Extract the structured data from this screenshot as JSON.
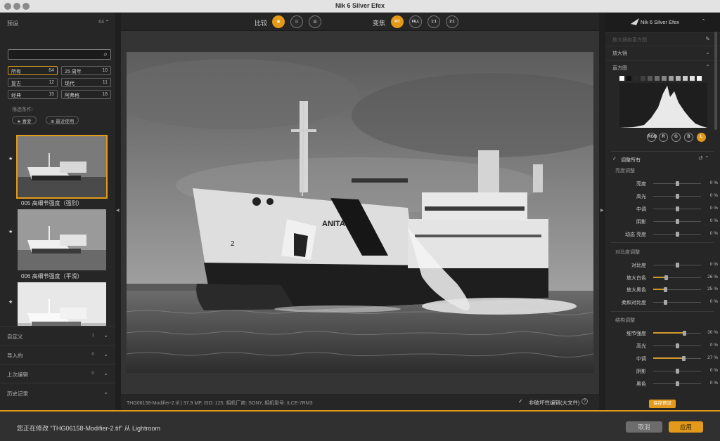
{
  "window": {
    "title": "Nik 6 Silver Efex"
  },
  "left": {
    "presets_label": "预设",
    "presets_count": "64",
    "search_placeholder": "",
    "filters": [
      {
        "label": "所有",
        "count": "64",
        "active": true
      },
      {
        "label": "25 周年",
        "count": "10"
      },
      {
        "label": "复古",
        "count": "12"
      },
      {
        "label": "现代",
        "count": "11"
      },
      {
        "label": "经典",
        "count": "15"
      },
      {
        "label": "阿弗格",
        "count": "16"
      }
    ],
    "filter_conditions_label": "筛选条件:",
    "pills": [
      "★ 喜爱",
      "⊕ 最近使用"
    ],
    "thumbs": [
      {
        "caption": "005 高细节强度（强烈）"
      },
      {
        "caption": "006 高细节强度（平滑）"
      },
      {
        "caption": ""
      }
    ],
    "sections": [
      {
        "label": "自定义",
        "count": "1"
      },
      {
        "label": "导入的",
        "count": "0"
      },
      {
        "label": "上次编辑",
        "count": "0"
      },
      {
        "label": "历史记录",
        "count": ""
      }
    ]
  },
  "toolbar": {
    "compare_label": "比较",
    "zoom_label": "变焦",
    "zoom_buttons": [
      "FIT",
      "FILL",
      "1:1",
      "2:1"
    ]
  },
  "status": {
    "info": "THG06158-Modifier-2.tif   |   37.9 MP, ISO: 125, 相机厂商: SONY, 相机型号: ILCE-7RM3",
    "nondestructive_label": "非破坏性编辑(大文件)",
    "help": "?"
  },
  "right": {
    "logo": "Nik 6 Silver Efex",
    "rows": [
      {
        "label": "放大镜和直方图",
        "dim": true
      },
      {
        "label": "放大镜"
      },
      {
        "label": "直方图"
      }
    ],
    "rgb_buttons": [
      "RGB",
      "R",
      "G",
      "B",
      "L"
    ],
    "adjust_all_label": "调整所有",
    "groups": {
      "brightness": "亮度调整",
      "contrast": "对比度调整",
      "structure": "结构调整"
    },
    "sliders": [
      {
        "label": "亮度",
        "value": "0 %",
        "frac": 0.5
      },
      {
        "label": "高光",
        "value": "0 %",
        "frac": 0.5
      },
      {
        "label": "中调",
        "value": "0 %",
        "frac": 0.5
      },
      {
        "label": "阴影",
        "value": "0 %",
        "frac": 0.5
      },
      {
        "label": "动态 亮度",
        "value": "0 %",
        "frac": 0.5
      },
      {
        "label": "对比度",
        "value": "0 %",
        "frac": 0.5
      },
      {
        "label": "放大白色",
        "value": "26 %",
        "frac": 0.26
      },
      {
        "label": "放大黑色",
        "value": "25 %",
        "frac": 0.25
      },
      {
        "label": "柔和对比度",
        "value": "0 %",
        "frac": 0.25
      },
      {
        "label": "细节强度",
        "value": "30 %",
        "frac": 0.65
      },
      {
        "label": "高光",
        "value": "0 %",
        "frac": 0.5
      },
      {
        "label": "中调",
        "value": "27 %",
        "frac": 0.635
      },
      {
        "label": "阴影",
        "value": "0 %",
        "frac": 0.5
      },
      {
        "label": "黑色",
        "value": "0 %",
        "frac": 0.5
      }
    ],
    "save_preset": "保存预设"
  },
  "bottom": {
    "message": "您正在修改 “THG06158-Modifier-2.tif” 从 Lightroom",
    "cancel": "取消",
    "apply": "应用"
  },
  "colors": {
    "accent": "#e39a1a"
  },
  "photo": {
    "hull_text": "ANITA",
    "bow_mark": "2"
  }
}
